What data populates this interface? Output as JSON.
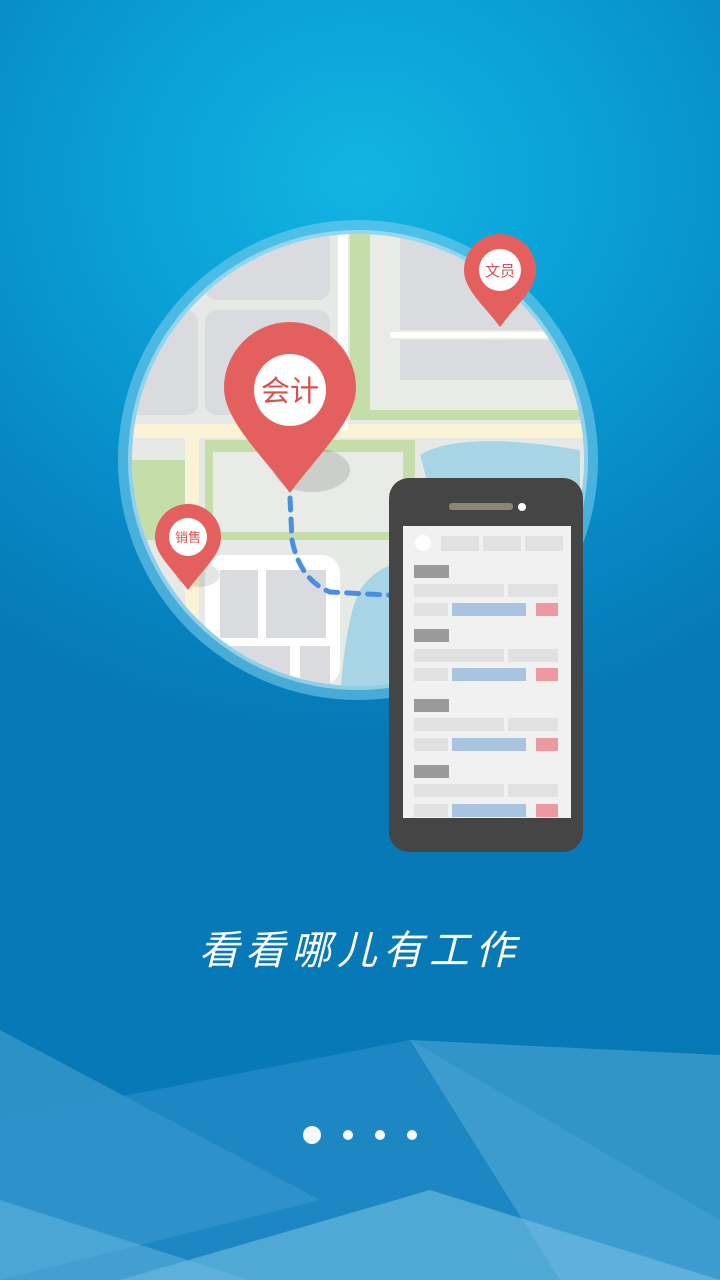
{
  "onboarding": {
    "headline": "看看哪儿有工作",
    "page_count": 4,
    "current_page": 1
  },
  "map_pins": {
    "accountant": "会计",
    "clerk": "文员",
    "sales": "销售"
  },
  "colors": {
    "background": "#0a9bd4",
    "pin": "#e4605f",
    "route": "#4a8ee0",
    "phone_body": "#454545"
  },
  "icons": [
    "map-illustration",
    "location-pin-icon",
    "phone-illustration"
  ]
}
